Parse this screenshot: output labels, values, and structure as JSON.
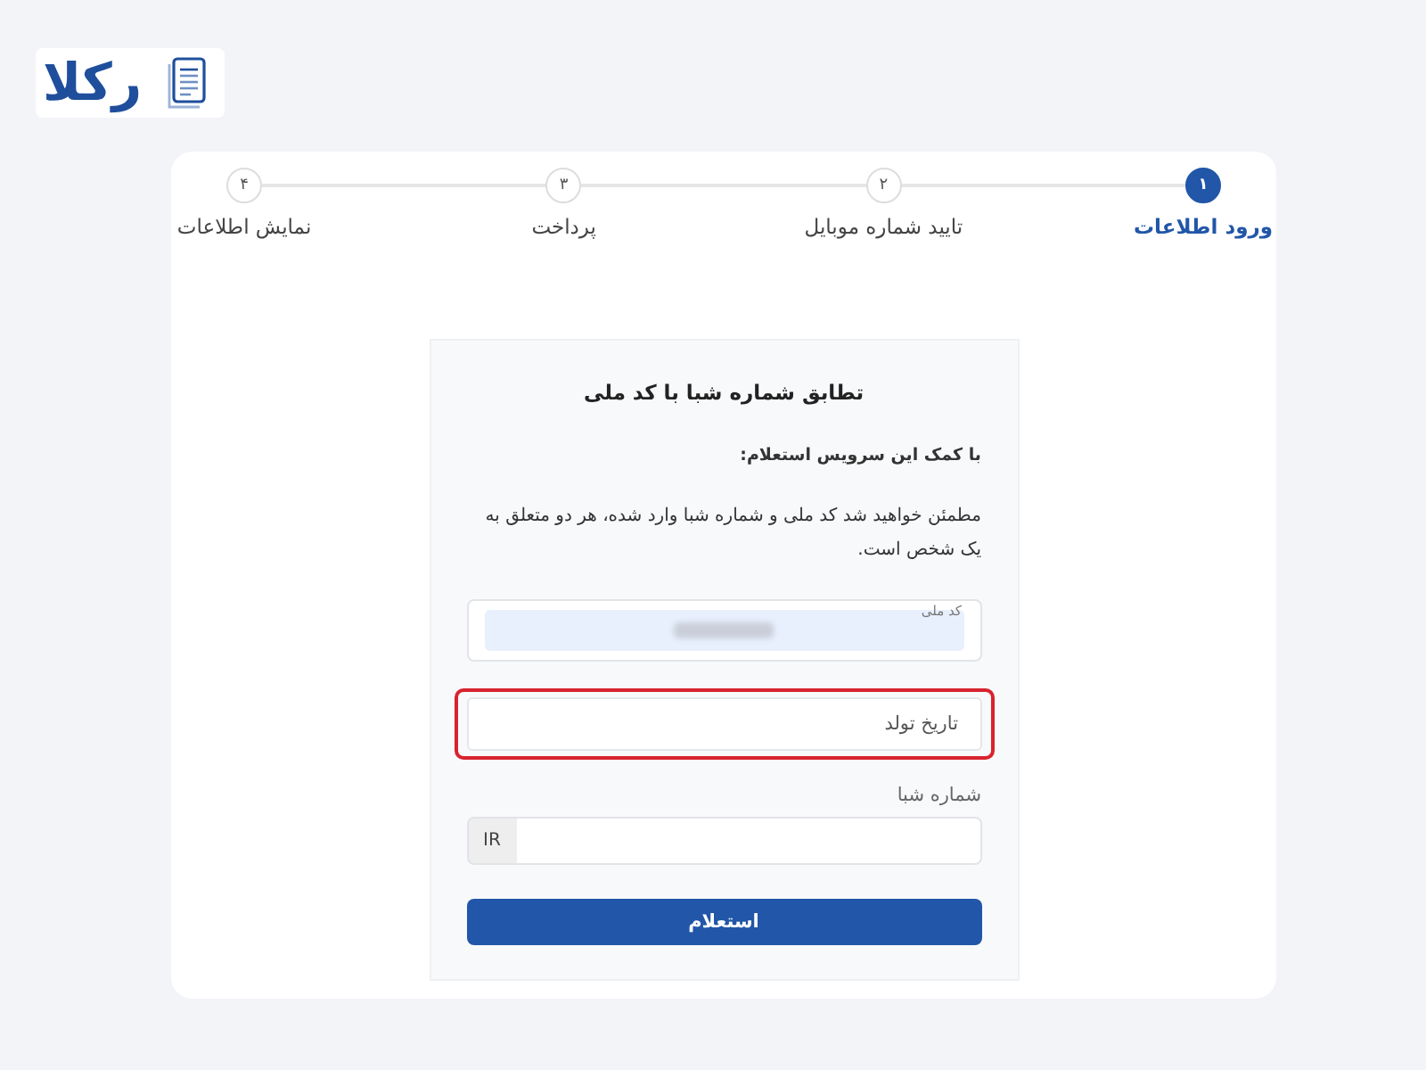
{
  "logo": {
    "text": "رکلا"
  },
  "steps": [
    {
      "number": "۱",
      "label": "ورود اطلاعات",
      "selected": true
    },
    {
      "number": "۲",
      "label": "تایید شماره موبایل",
      "selected": false
    },
    {
      "number": "۳",
      "label": "پرداخت",
      "selected": false
    },
    {
      "number": "۴",
      "label": "نمایش اطلاعات",
      "selected": false
    }
  ],
  "form": {
    "title": "تطابق شماره شبا با کد ملی",
    "intro": "با کمک این سرویس استعلام:",
    "description": "مطمئن خواهید شد کد ملی و شماره شبا وارد شده، هر دو متعلق به یک شخص است.",
    "national_id": {
      "label": "کد ملی",
      "value_hidden": true
    },
    "birth_date": {
      "placeholder": "تاریخ تولد",
      "highlighted": true
    },
    "sheba": {
      "label": "شماره شبا",
      "prefix": "IR"
    },
    "submit_button": "استعلام"
  }
}
